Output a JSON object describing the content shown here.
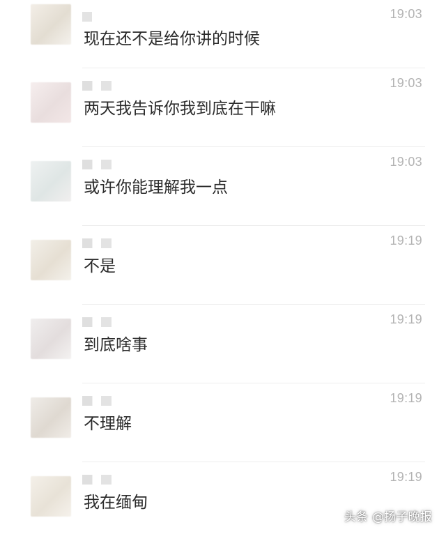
{
  "messages": [
    {
      "time": "19:03",
      "text": "现在还不是给你讲的时候"
    },
    {
      "time": "19:03",
      "text": "两天我告诉你我到底在干嘛"
    },
    {
      "time": "19:03",
      "text": "或许你能理解我一点"
    },
    {
      "time": "19:19",
      "text": "不是"
    },
    {
      "time": "19:19",
      "text": "到底啥事"
    },
    {
      "time": "19:19",
      "text": "不理解"
    },
    {
      "time": "19:19",
      "text": "我在缅甸"
    }
  ],
  "watermark": "头条 @扬子晚报"
}
